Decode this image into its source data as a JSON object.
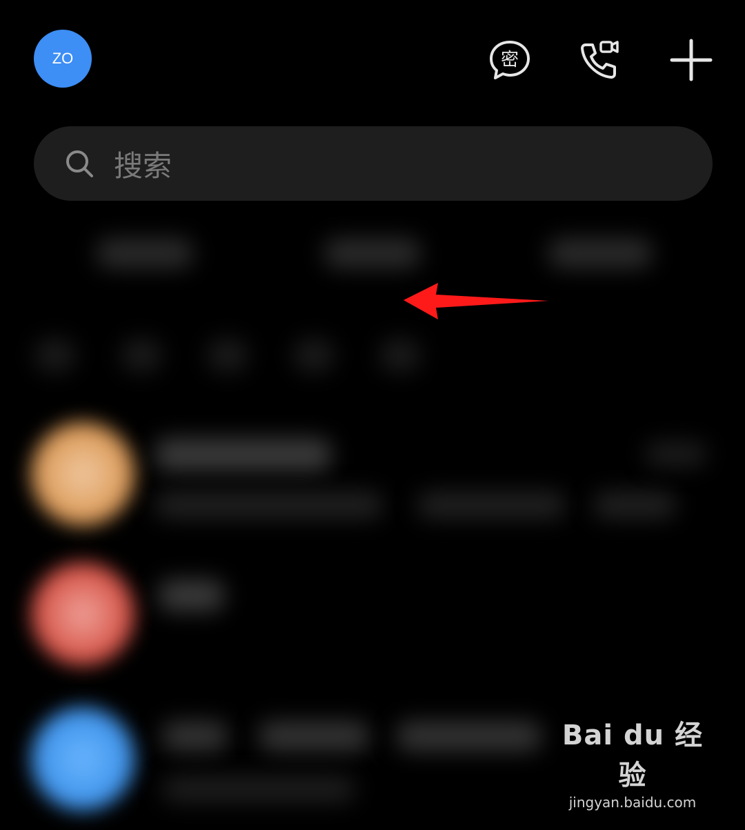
{
  "header": {
    "avatar_initials": "ZO",
    "icons": [
      "secret-chat-icon",
      "call-video-icon",
      "plus-icon"
    ],
    "secret_chat_glyph": "密"
  },
  "search": {
    "placeholder": "搜索"
  },
  "colors": {
    "avatar": "#3d8ef5",
    "background": "#000000",
    "search_bg": "#1e1e1e",
    "arrow": "#ff1a1a",
    "chat_avatar_1": "#e8b07a",
    "chat_avatar_2": "#e05a4e",
    "chat_avatar_3": "#4a9cf0"
  },
  "watermark": {
    "brand": "Bai du 经验",
    "url": "jingyan.baidu.com"
  }
}
